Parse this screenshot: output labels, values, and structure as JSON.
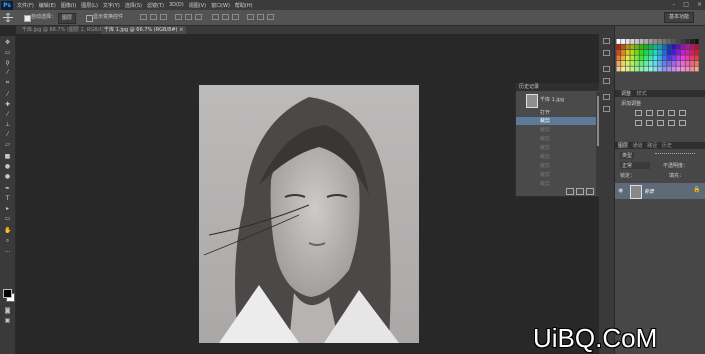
{
  "app": {
    "logo": "Ps"
  },
  "menu": [
    "文件(F)",
    "编辑(E)",
    "图像(I)",
    "图层(L)",
    "文字(Y)",
    "选择(S)",
    "滤镜(T)",
    "3D(D)",
    "视图(V)",
    "窗口(W)",
    "帮助(H)"
  ],
  "window_controls": [
    "–",
    "□",
    "×"
  ],
  "options": {
    "auto_select": "自动选择：",
    "target": "图层",
    "transform": "显示变换控件",
    "workspace": "基本功能"
  },
  "tabs": [
    {
      "label": "千库.jpg @ 66.7% (图层 1, RGB/8#) ×"
    },
    {
      "label": "千库 1.jpg @ 66.7% (RGB/8#) ×"
    }
  ],
  "history": {
    "title": "历史记录",
    "snapshot": "千库 1.jpg",
    "items": [
      "打开",
      "裁剪",
      "裁剪",
      "裁剪",
      "裁剪",
      "裁剪",
      "裁剪",
      "裁剪",
      "裁剪"
    ]
  },
  "adjust": {
    "title": "调整",
    "styles": "样式",
    "add_label": "添加调整"
  },
  "layers": {
    "tabs": [
      "图层",
      "通道",
      "路径",
      "历史"
    ],
    "kind": "类型",
    "blend": "正常",
    "opacity_label": "不透明度：",
    "lock_label": "锁定：",
    "fill_label": "填充：",
    "layer_name": "背景"
  },
  "watermark": "UiBQ.CoM",
  "colors": {
    "accent": "#35a6ff",
    "panel": "#474747",
    "canvas": "#282828",
    "watermark": "#ffffff"
  }
}
